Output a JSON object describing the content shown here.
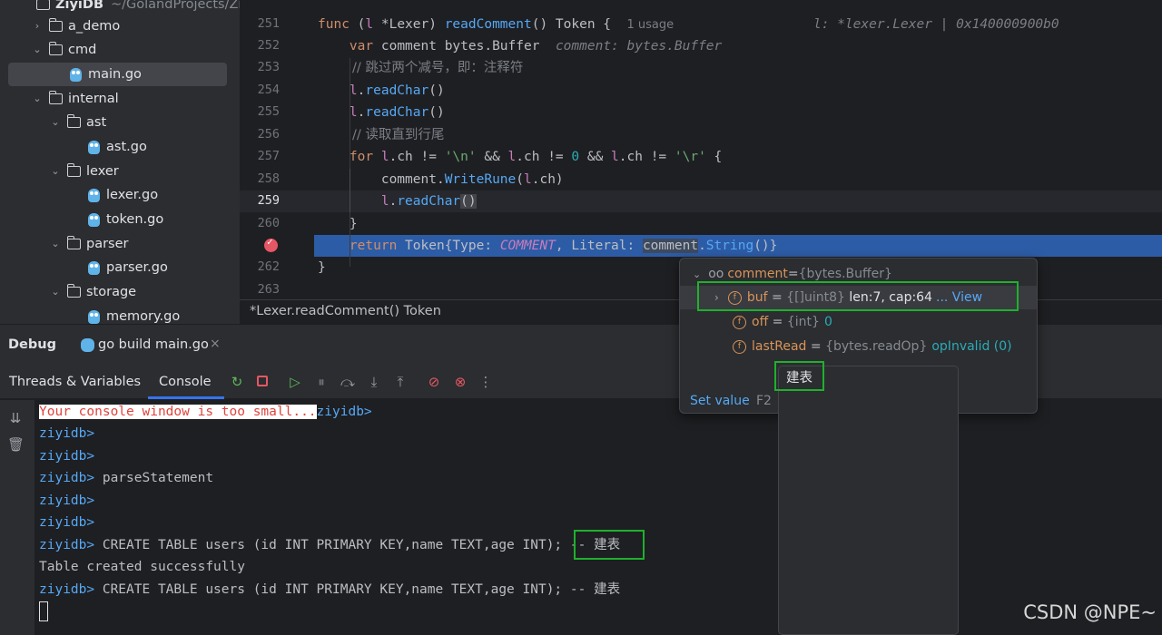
{
  "tree": {
    "root": {
      "name": "ZiyiDB",
      "path": "~/GolandProjects/ZiyiD"
    },
    "items": [
      {
        "label": "a_demo",
        "kind": "folder",
        "expanded": false
      },
      {
        "label": "cmd",
        "kind": "folder",
        "expanded": true
      },
      {
        "label": "main.go",
        "kind": "file"
      },
      {
        "label": "internal",
        "kind": "folder",
        "expanded": true
      },
      {
        "label": "ast",
        "kind": "folder",
        "expanded": true
      },
      {
        "label": "ast.go",
        "kind": "file"
      },
      {
        "label": "lexer",
        "kind": "folder",
        "expanded": true
      },
      {
        "label": "lexer.go",
        "kind": "file"
      },
      {
        "label": "token.go",
        "kind": "file"
      },
      {
        "label": "parser",
        "kind": "folder",
        "expanded": true
      },
      {
        "label": "parser.go",
        "kind": "file"
      },
      {
        "label": "storage",
        "kind": "folder",
        "expanded": true
      },
      {
        "label": "memory.go",
        "kind": "file"
      }
    ]
  },
  "editor": {
    "line_numbers": [
      "251",
      "252",
      "253",
      "254",
      "255",
      "256",
      "257",
      "258",
      "259",
      "260",
      "",
      "262",
      "263"
    ],
    "usage_hint": "1 usage",
    "receiver_hint": "l: *lexer.Lexer | 0x140000900b0",
    "comment_hint": "comment: bytes.Buffer",
    "breadcrumb": "*Lexer.readComment() Token",
    "comment1": "// 跳过两个减号，即：注释符",
    "comment2": "// 读取直到行尾"
  },
  "debug": {
    "title": "Debug",
    "session_tab": "go build main.go",
    "tabs": [
      "Threads & Variables",
      "Console"
    ]
  },
  "console": {
    "lines": [
      {
        "warning": "Your console window is too small...",
        "prompt": "ziyidb>",
        "text": ""
      },
      {
        "prompt": "ziyidb>",
        "text": ""
      },
      {
        "prompt": "ziyidb>",
        "text": ""
      },
      {
        "prompt": "ziyidb>",
        "text": " parseStatement"
      },
      {
        "prompt": "ziyidb>",
        "text": ""
      },
      {
        "prompt": "ziyidb>",
        "text": ""
      },
      {
        "prompt": "ziyidb>",
        "text": " CREATE TABLE users (id INT PRIMARY KEY,name TEXT,age INT);",
        "tail": " -- 建表"
      },
      {
        "prompt": "",
        "text": "Table created successfully"
      },
      {
        "prompt": "ziyidb>",
        "text": " CREATE TABLE users (id INT PRIMARY KEY,name TEXT,age INT); -- 建表"
      }
    ]
  },
  "inspect": {
    "root_name": "comment",
    "root_type": "{bytes.Buffer}",
    "fields": [
      {
        "name": "buf",
        "type": "{[]uint8}",
        "value": "len:7, cap:64",
        "link": "... View"
      },
      {
        "name": "off",
        "type": "{int}",
        "value": "0",
        "link": ""
      },
      {
        "name": "lastRead",
        "type": "{bytes.readOp}",
        "value": "opInvalid (0)",
        "link": ""
      }
    ],
    "set_value": "Set value",
    "shortcut": "F2"
  },
  "ime": {
    "candidate": "建表"
  },
  "watermark": "CSDN @NPE~"
}
